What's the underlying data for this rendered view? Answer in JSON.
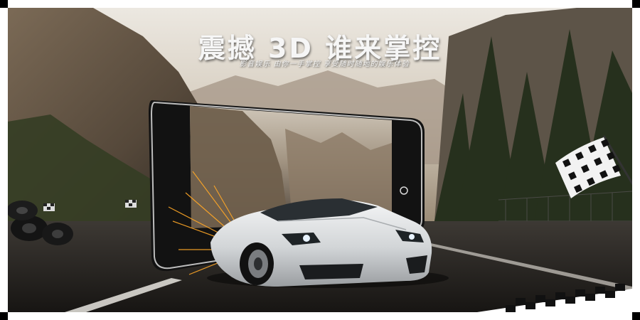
{
  "banner": {
    "headline": "震撼 3D 谁来掌控",
    "subline": "影音娱乐  由你一手掌控  享受随时随地的娱乐体验"
  },
  "scene": {
    "subjects": [
      "smartphone",
      "sports-car",
      "mountain-road",
      "checkered-flag",
      "stacked-tires"
    ],
    "colors": {
      "sky": "#e3ddd3",
      "rock": "#6b5a48",
      "forest": "#2f3a25",
      "road": "#2b2825",
      "phone": "#1a1a1a",
      "car": "#d9dbdc",
      "sparks": "#ff9a1e"
    }
  }
}
